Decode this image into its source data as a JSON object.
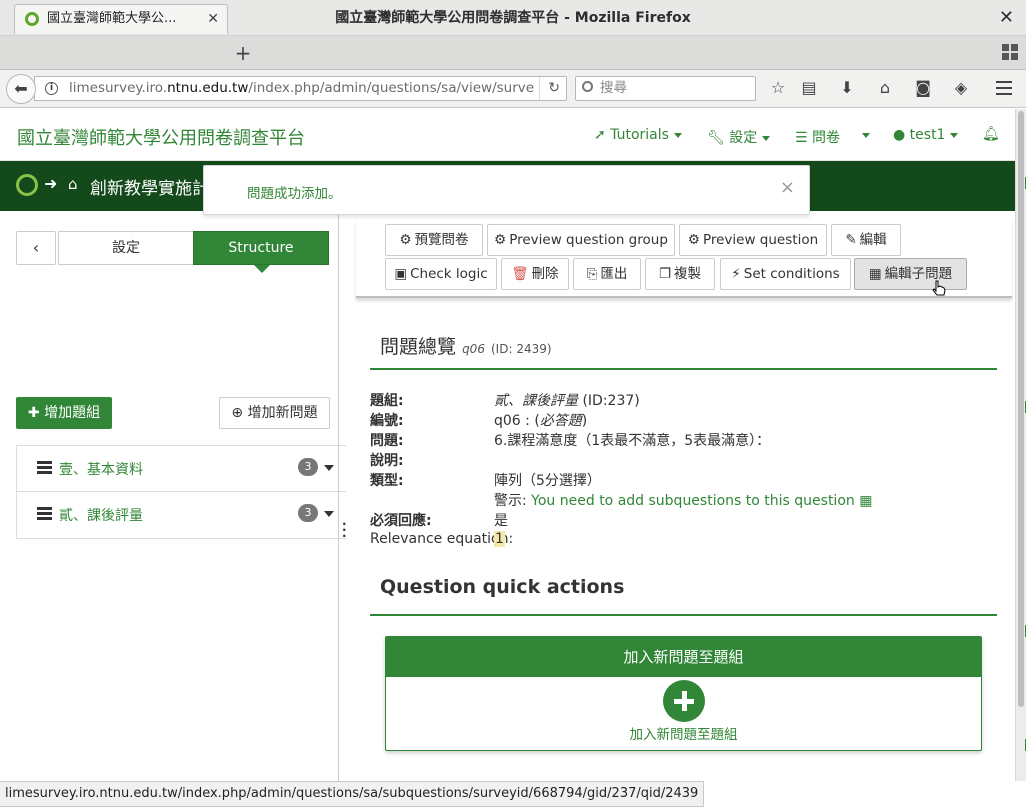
{
  "browser": {
    "window_title": "國立臺灣師範大學公用問卷調查平台 - Mozilla Firefox",
    "tab_title": "國立臺灣師範大學公...",
    "url_prefix": "limesurvey.iro.",
    "url_domain": "ntnu.edu.tw",
    "url_path": "/index.php/admin/questions/sa/view/surve",
    "search_placeholder": "搜尋",
    "status_url": "limesurvey.iro.ntnu.edu.tw/index.php/admin/questions/sa/subquestions/surveyid/668794/gid/237/qid/2439"
  },
  "topnav": {
    "brand": "國立臺灣師範大學公用問卷調查平台",
    "tutorials": "Tutorials",
    "settings": "設定",
    "surveys": "問卷",
    "user": "test1"
  },
  "survey_bar": {
    "title": "創新教學實施計"
  },
  "flash": {
    "message": "問題成功添加。",
    "close": "×"
  },
  "sidebar": {
    "tab_settings": "設定",
    "tab_structure": "Structure",
    "add_group": "增加題組",
    "add_question": "增加新問題",
    "groups": [
      {
        "label": "壹、基本資料",
        "count": "3"
      },
      {
        "label": "貳、課後評量",
        "count": "3"
      }
    ]
  },
  "toolbar": {
    "preview_survey": "預覽問卷",
    "preview_group": "Preview question group",
    "preview_question": "Preview question",
    "edit": "編輯",
    "check_logic": "Check logic",
    "delete": "刪除",
    "export": "匯出",
    "copy": "複製",
    "set_conditions": "Set conditions",
    "edit_subquestions": "編輯子問題"
  },
  "summary": {
    "title": "問題總覽",
    "code": "q06",
    "id_text": "(ID: 2439)",
    "rows": [
      {
        "key": "題組:",
        "value_italic": "貳、課後評量",
        "value": " (ID:237)"
      },
      {
        "key": "編號:",
        "value": "q06 : (",
        "value_italic": "必答題",
        "value_end": ")"
      },
      {
        "key": "問題:",
        "value": "6.課程滿意度（1表最不滿意，5表最滿意）："
      },
      {
        "key": "說明:",
        "value": ""
      },
      {
        "key": "類型:",
        "value": "陣列（5分選擇）"
      },
      {
        "key": "",
        "value": "警示: ",
        "value_green": "You need to add subquestions to this question"
      },
      {
        "key": "必須回應:",
        "value": "是"
      },
      {
        "key": "Relevance equation:",
        "value": "1"
      }
    ]
  },
  "quick_actions": {
    "title": "Question quick actions",
    "card_header": "加入新問題至題組",
    "card_label": "加入新問題至題組"
  },
  "colors": {
    "brand_green": "#328637",
    "dark_green": "#14491b",
    "badge": "#777777"
  }
}
